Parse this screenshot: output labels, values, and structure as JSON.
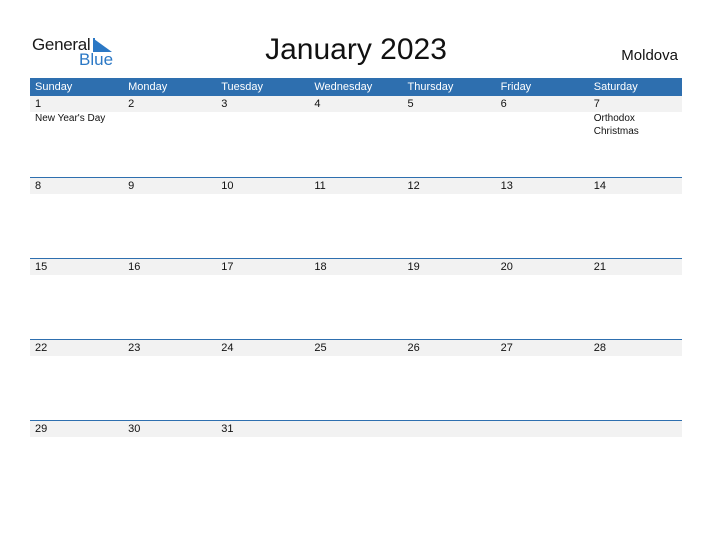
{
  "logo": {
    "word1": "General",
    "word2": "Blue"
  },
  "title": "January 2023",
  "country": "Moldova",
  "colors": {
    "header_bg": "#2e6faf",
    "accent": "#2b78c5",
    "day_band": "#f2f2f2"
  },
  "weekdays": [
    "Sunday",
    "Monday",
    "Tuesday",
    "Wednesday",
    "Thursday",
    "Friday",
    "Saturday"
  ],
  "weeks": [
    [
      {
        "day": "1",
        "holiday": "New Year's Day"
      },
      {
        "day": "2",
        "holiday": ""
      },
      {
        "day": "3",
        "holiday": ""
      },
      {
        "day": "4",
        "holiday": ""
      },
      {
        "day": "5",
        "holiday": ""
      },
      {
        "day": "6",
        "holiday": ""
      },
      {
        "day": "7",
        "holiday": "Orthodox Christmas"
      }
    ],
    [
      {
        "day": "8",
        "holiday": ""
      },
      {
        "day": "9",
        "holiday": ""
      },
      {
        "day": "10",
        "holiday": ""
      },
      {
        "day": "11",
        "holiday": ""
      },
      {
        "day": "12",
        "holiday": ""
      },
      {
        "day": "13",
        "holiday": ""
      },
      {
        "day": "14",
        "holiday": ""
      }
    ],
    [
      {
        "day": "15",
        "holiday": ""
      },
      {
        "day": "16",
        "holiday": ""
      },
      {
        "day": "17",
        "holiday": ""
      },
      {
        "day": "18",
        "holiday": ""
      },
      {
        "day": "19",
        "holiday": ""
      },
      {
        "day": "20",
        "holiday": ""
      },
      {
        "day": "21",
        "holiday": ""
      }
    ],
    [
      {
        "day": "22",
        "holiday": ""
      },
      {
        "day": "23",
        "holiday": ""
      },
      {
        "day": "24",
        "holiday": ""
      },
      {
        "day": "25",
        "holiday": ""
      },
      {
        "day": "26",
        "holiday": ""
      },
      {
        "day": "27",
        "holiday": ""
      },
      {
        "day": "28",
        "holiday": ""
      }
    ],
    [
      {
        "day": "29",
        "holiday": ""
      },
      {
        "day": "30",
        "holiday": ""
      },
      {
        "day": "31",
        "holiday": ""
      },
      {
        "day": "",
        "holiday": ""
      },
      {
        "day": "",
        "holiday": ""
      },
      {
        "day": "",
        "holiday": ""
      },
      {
        "day": "",
        "holiday": ""
      }
    ]
  ]
}
